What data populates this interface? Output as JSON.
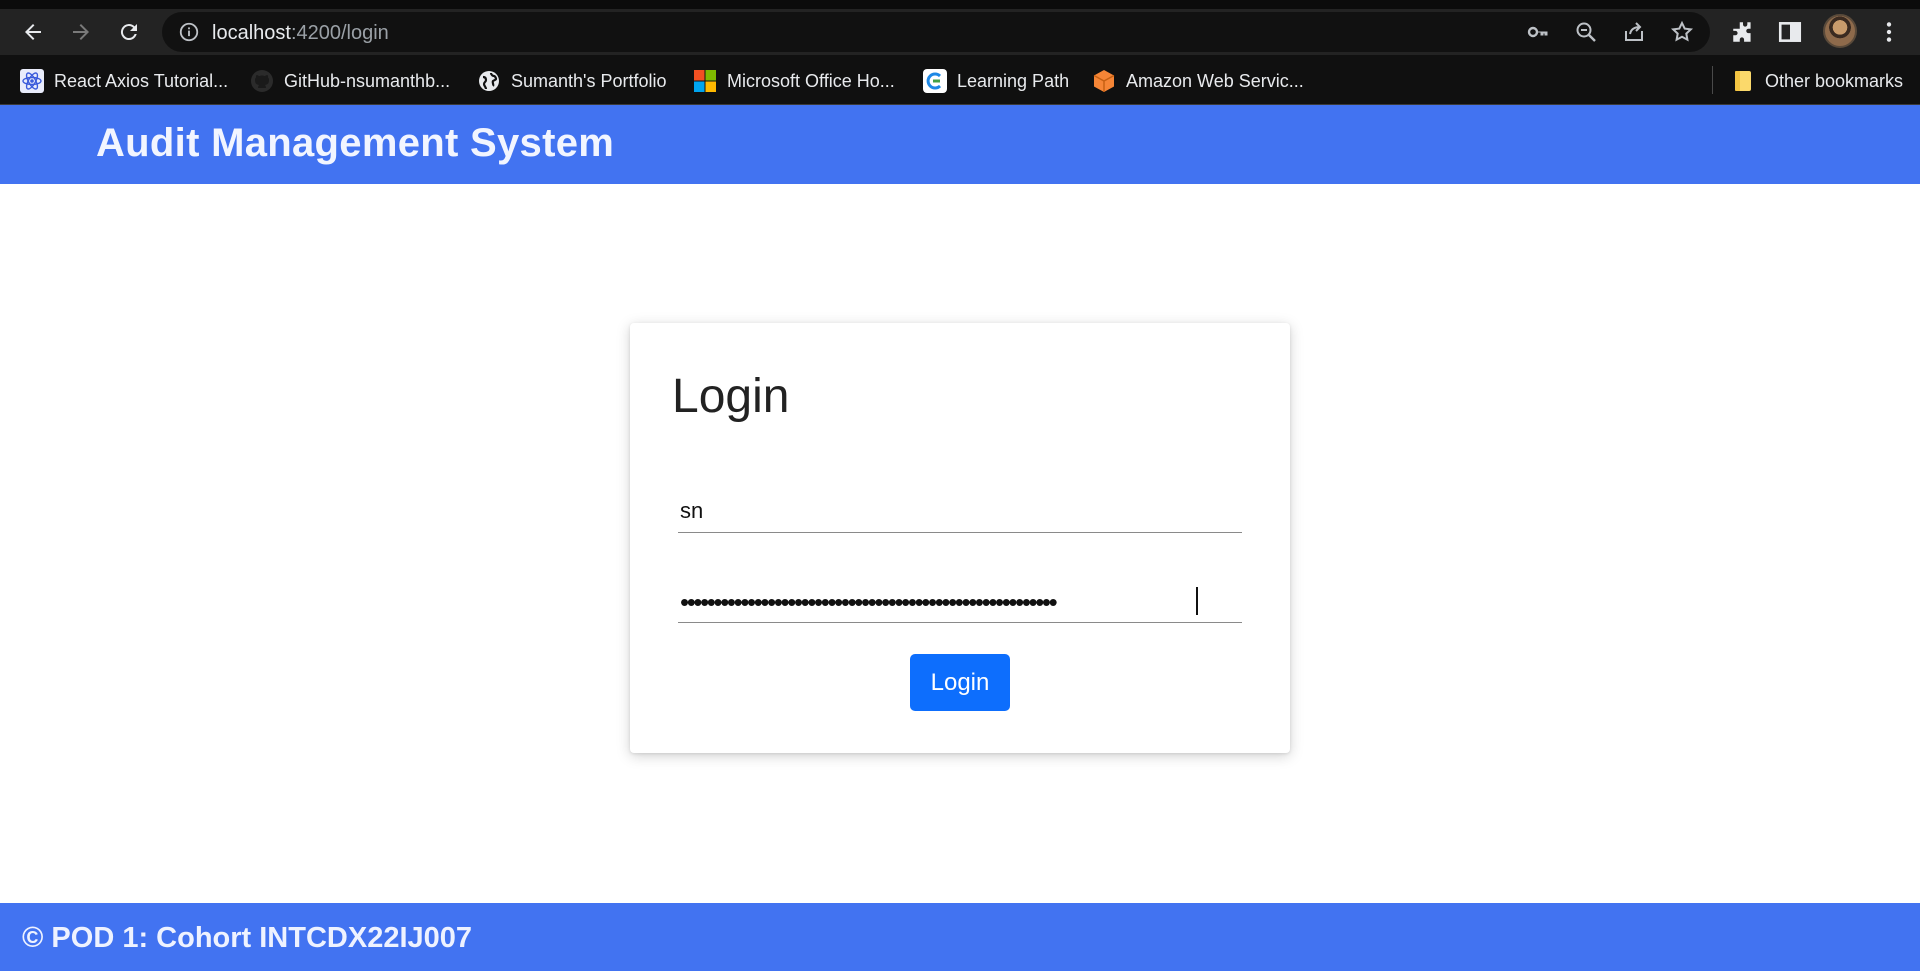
{
  "browser": {
    "url_host": "localhost",
    "url_path": ":4200/login",
    "bookmarks": [
      {
        "label": "React Axios Tutorial...",
        "icon": "react-icon"
      },
      {
        "label": "GitHub-nsumanthb...",
        "icon": "github-icon"
      },
      {
        "label": "Sumanth's Portfolio",
        "icon": "globe-icon"
      },
      {
        "label": "Microsoft Office Ho...",
        "icon": "microsoft-icon"
      },
      {
        "label": "Learning Path",
        "icon": "learning-path-icon"
      },
      {
        "label": "Amazon Web Servic...",
        "icon": "aws-icon"
      }
    ],
    "other_bookmarks": "Other bookmarks"
  },
  "header": {
    "title": "Audit Management System",
    "color": "#4273f1"
  },
  "login": {
    "title": "Login",
    "username_value": "sn",
    "password_mask": "••••••••••••••••••••••••••••••••••••••••••••••••••••••••",
    "button_label": "Login",
    "button_color": "#0d6efd"
  },
  "footer": {
    "text": "© POD 1: Cohort INTCDX22IJ007"
  }
}
